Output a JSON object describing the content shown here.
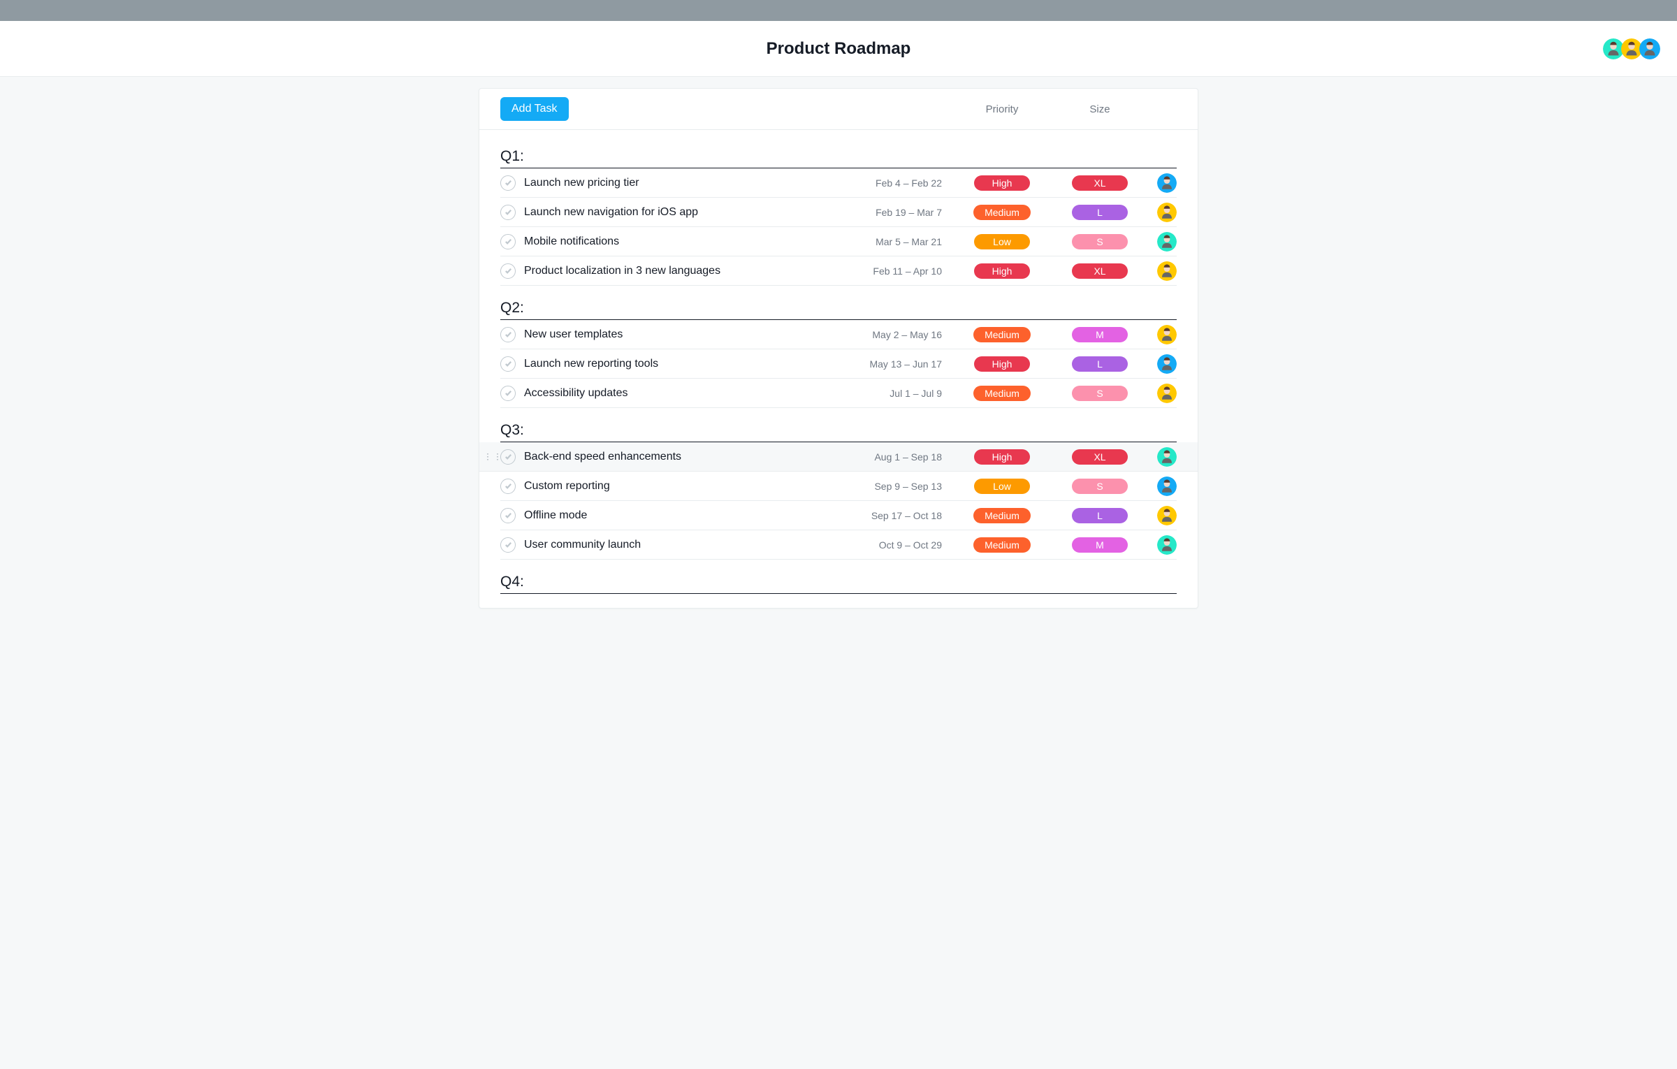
{
  "header": {
    "title": "Product Roadmap",
    "members": [
      "green",
      "yellow",
      "blue"
    ]
  },
  "toolbar": {
    "add_task_label": "Add Task",
    "col_priority": "Priority",
    "col_size": "Size"
  },
  "colors": {
    "priority": {
      "High": "#e8384f",
      "Medium": "#fd612c",
      "Low": "#fd9a00"
    },
    "size": {
      "XL": "#e8384f",
      "L": "#aa62e3",
      "M": "#e362e3",
      "S": "#fc91ad"
    },
    "avatar": {
      "green": "#25e8c8",
      "yellow": "#ffc800",
      "blue": "#14aaf5"
    }
  },
  "sections": [
    {
      "title": "Q1:",
      "tasks": [
        {
          "name": "Launch new pricing tier",
          "dates": "Feb 4 – Feb 22",
          "priority": "High",
          "size": "XL",
          "assignee": "blue"
        },
        {
          "name": "Launch new navigation for iOS app",
          "dates": "Feb 19 – Mar 7",
          "priority": "Medium",
          "size": "L",
          "assignee": "yellow"
        },
        {
          "name": "Mobile notifications",
          "dates": "Mar 5 – Mar 21",
          "priority": "Low",
          "size": "S",
          "assignee": "green"
        },
        {
          "name": "Product localization in 3 new languages",
          "dates": "Feb 11 – Apr 10",
          "priority": "High",
          "size": "XL",
          "assignee": "yellow"
        }
      ]
    },
    {
      "title": "Q2:",
      "tasks": [
        {
          "name": "New user templates",
          "dates": "May 2 – May 16",
          "priority": "Medium",
          "size": "M",
          "assignee": "yellow"
        },
        {
          "name": "Launch new reporting tools",
          "dates": "May 13 – Jun 17",
          "priority": "High",
          "size": "L",
          "assignee": "blue"
        },
        {
          "name": "Accessibility updates",
          "dates": "Jul 1 – Jul 9",
          "priority": "Medium",
          "size": "S",
          "assignee": "yellow"
        }
      ]
    },
    {
      "title": "Q3:",
      "tasks": [
        {
          "name": "Back-end speed enhancements",
          "dates": "Aug 1 – Sep 18",
          "priority": "High",
          "size": "XL",
          "assignee": "green",
          "hovered": true
        },
        {
          "name": "Custom reporting",
          "dates": "Sep 9 – Sep 13",
          "priority": "Low",
          "size": "S",
          "assignee": "blue"
        },
        {
          "name": "Offline mode",
          "dates": "Sep 17 – Oct 18",
          "priority": "Medium",
          "size": "L",
          "assignee": "yellow"
        },
        {
          "name": "User community launch",
          "dates": "Oct 9 – Oct 29",
          "priority": "Medium",
          "size": "M",
          "assignee": "green"
        }
      ]
    },
    {
      "title": "Q4:",
      "tasks": []
    }
  ]
}
